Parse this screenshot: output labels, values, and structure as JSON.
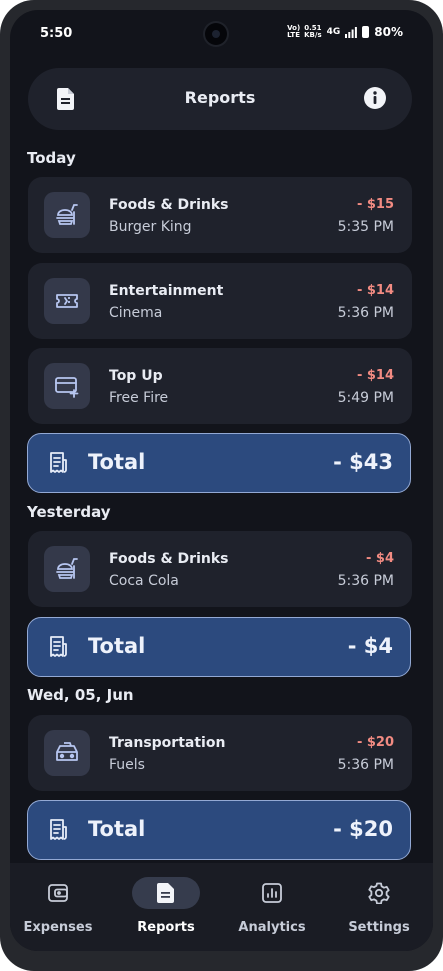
{
  "status_bar": {
    "time": "5:50",
    "volte": "Vo) LTE",
    "speed_value": "0.51",
    "speed_unit": "KB/s",
    "network": "4G",
    "battery": "80%"
  },
  "header": {
    "title": "Reports",
    "left_icon": "document-icon",
    "right_icon": "info-icon"
  },
  "groups": [
    {
      "label": "Today",
      "transactions": [
        {
          "icon": "food-drink-icon",
          "category": "Foods & Drinks",
          "merchant": "Burger King",
          "amount": "- $15",
          "time": "5:35 PM"
        },
        {
          "icon": "ticket-icon",
          "category": "Entertainment",
          "merchant": "Cinema",
          "amount": "- $14",
          "time": "5:36 PM"
        },
        {
          "icon": "card-add-icon",
          "category": "Top Up",
          "merchant": "Free Fire",
          "amount": "- $14",
          "time": "5:49 PM"
        }
      ],
      "total_label": "Total",
      "total_amount": "- $43"
    },
    {
      "label": "Yesterday",
      "transactions": [
        {
          "icon": "food-drink-icon",
          "category": "Foods & Drinks",
          "merchant": "Coca Cola",
          "amount": "- $4",
          "time": "5:36 PM"
        }
      ],
      "total_label": "Total",
      "total_amount": "- $4"
    },
    {
      "label": "Wed, 05, Jun",
      "transactions": [
        {
          "icon": "car-icon",
          "category": "Transportation",
          "merchant": "Fuels",
          "amount": "- $20",
          "time": "5:36 PM"
        }
      ],
      "total_label": "Total",
      "total_amount": "- $20"
    }
  ],
  "nav": [
    {
      "label": "Expenses",
      "icon": "wallet-icon",
      "active": false
    },
    {
      "label": "Reports",
      "icon": "report-icon",
      "active": true
    },
    {
      "label": "Analytics",
      "icon": "chart-icon",
      "active": false
    },
    {
      "label": "Settings",
      "icon": "gear-icon",
      "active": false
    }
  ],
  "colors": {
    "background": "#12141b",
    "card": "#1f222c",
    "total_fill": "#2c4a7e",
    "total_border": "#93a9d4",
    "expense_amount": "#f28b82"
  }
}
